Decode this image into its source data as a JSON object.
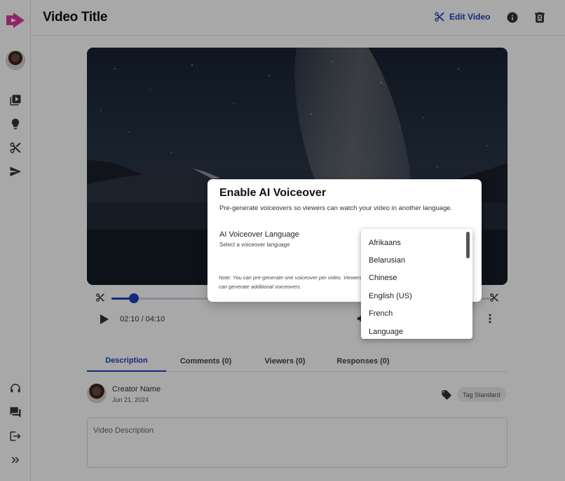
{
  "header": {
    "title": "Video Title",
    "edit_label": "Edit Video"
  },
  "sidebar": {
    "icons": [
      "video-library-icon",
      "lightbulb-icon",
      "scissors-icon",
      "send-icon",
      "support-icon",
      "chat-icon",
      "logout-icon",
      "expand-icon"
    ]
  },
  "player": {
    "time": "02:10 / 04:10",
    "progress": 0.06
  },
  "tabs": [
    {
      "label": "Description"
    },
    {
      "label": "Comments (0)"
    },
    {
      "label": "Viewers (0)"
    },
    {
      "label": "Responses (0)"
    }
  ],
  "creator": {
    "name": "Creator Name",
    "date": "Jun 21, 2024"
  },
  "tag": "Tag Standard",
  "description_placeholder": "Video Description",
  "modal": {
    "title": "Enable AI Voiceover",
    "subtitle": "Pre-generate voiceovers so viewers can watch your video in another language.",
    "language_label": "AI Voiceover Language",
    "language_hint": "Select a voiceover language",
    "note": "Note: You can pre-generate one voiceover per video. Viewers can generate additional voiceovers."
  },
  "dropdown": {
    "options": [
      "Afrikaans",
      "Belarusian",
      "Chinese",
      "English (US)",
      "French",
      "Language"
    ]
  },
  "colors": {
    "accent": "#1f3fbf",
    "logo": "#d63aa0"
  }
}
